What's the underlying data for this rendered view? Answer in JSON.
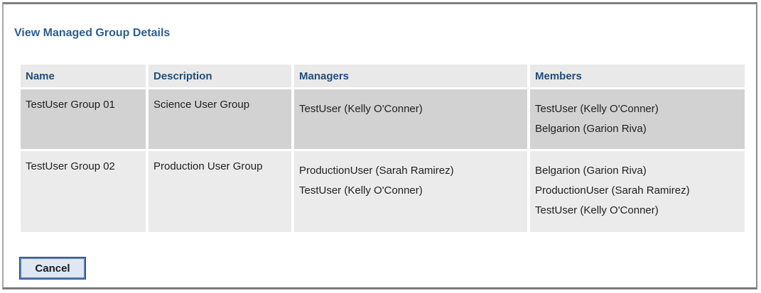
{
  "page": {
    "title": "View Managed Group Details"
  },
  "table": {
    "headers": {
      "name": "Name",
      "description": "Description",
      "managers": "Managers",
      "members": "Members"
    },
    "rows": [
      {
        "name": "TestUser Group 01",
        "description": "Science User Group",
        "managers": [
          "TestUser (Kelly O'Conner)"
        ],
        "members": [
          "TestUser (Kelly O'Conner)",
          "Belgarion (Garion Riva)"
        ]
      },
      {
        "name": "TestUser Group 02",
        "description": "Production User Group",
        "managers": [
          "ProductionUser (Sarah Ramirez)",
          "TestUser (Kelly O'Conner)"
        ],
        "members": [
          "Belgarion (Garion Riva)",
          "ProductionUser (Sarah Ramirez)",
          "TestUser (Kelly O'Conner)"
        ]
      }
    ]
  },
  "actions": {
    "cancel_label": "Cancel"
  },
  "colors": {
    "title": "#2d5f91",
    "header_text": "#1f4d7a",
    "row_dark": "#d2d2d2",
    "row_light": "#ebebeb",
    "button_border": "#5b7fb3"
  }
}
